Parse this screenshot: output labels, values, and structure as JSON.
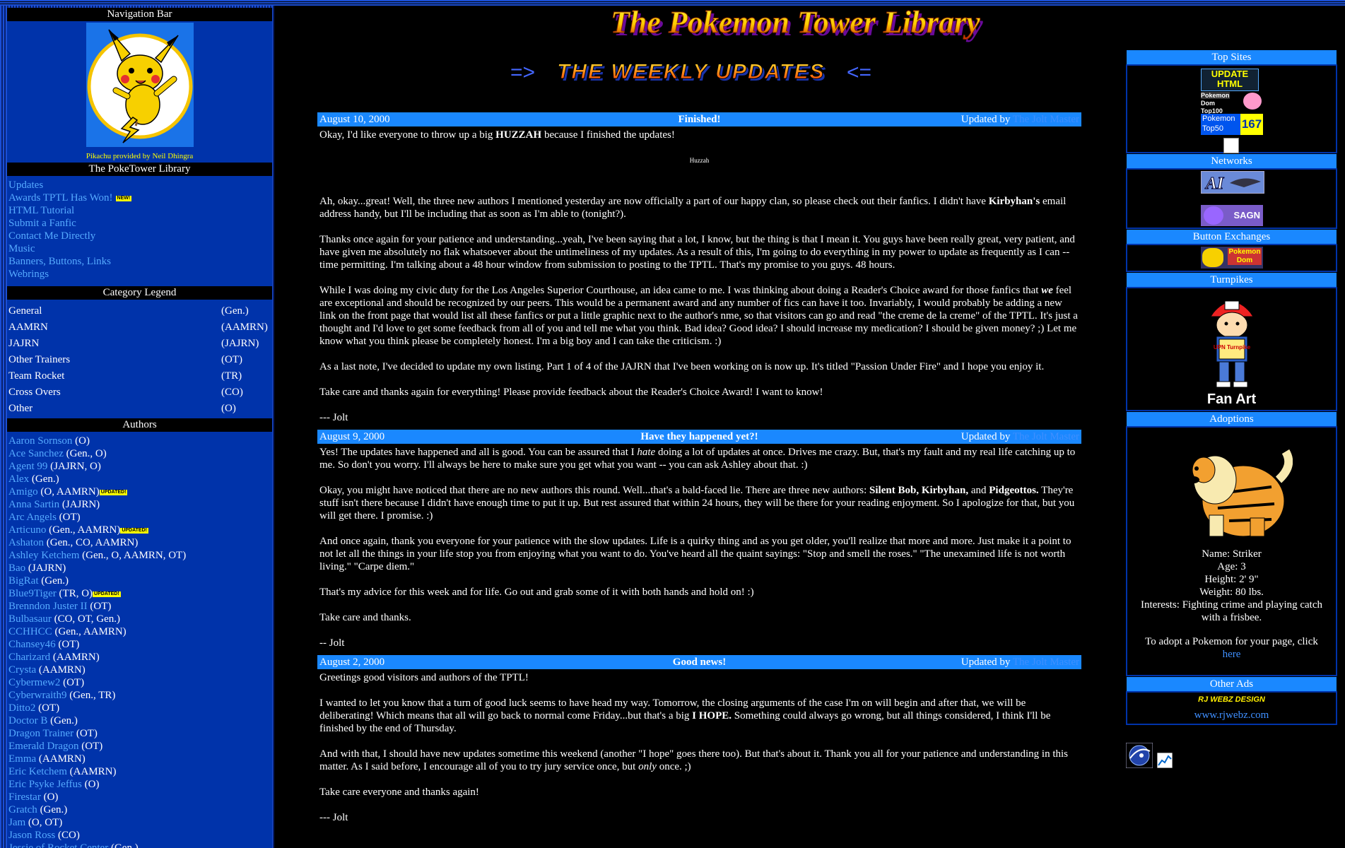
{
  "site_title": "The Pokemon Tower Library",
  "weekly_header": {
    "left_arrow": "=>",
    "text": "THE WEEKLY UPDATES",
    "right_arrow": "<="
  },
  "sidebar": {
    "nav_header": "Navigation Bar",
    "pika_credit": "Pikachu provided by Neil Dhingra",
    "library_header": "The PokeTower Library",
    "links": [
      {
        "label": "Updates"
      },
      {
        "label": "Awards TPTL Has Won!",
        "badge": "NEW!"
      },
      {
        "label": "HTML Tutorial"
      },
      {
        "label": "Submit a Fanfic"
      },
      {
        "label": "Contact Me Directly"
      },
      {
        "label": "Music"
      },
      {
        "label": "Banners, Buttons, Links"
      },
      {
        "label": "Webrings"
      }
    ],
    "legend_header": "Category Legend",
    "legend": [
      {
        "name": "General",
        "code": "(Gen.)"
      },
      {
        "name": "AAMRN",
        "code": "(AAMRN)"
      },
      {
        "name": "JAJRN",
        "code": "(JAJRN)"
      },
      {
        "name": "Other Trainers",
        "code": "(OT)"
      },
      {
        "name": "Team Rocket",
        "code": "(TR)"
      },
      {
        "name": "Cross Overs",
        "code": "(CO)"
      },
      {
        "name": "Other",
        "code": "(O)"
      }
    ],
    "authors_header": "Authors",
    "updated_badge": "UPDATED!",
    "authors": [
      {
        "name": "Aaron Sornson",
        "cats": "(O)"
      },
      {
        "name": "Ace Sanchez",
        "cats": "(Gen., O)"
      },
      {
        "name": "Agent 99",
        "cats": "(JAJRN, O)"
      },
      {
        "name": "Alex",
        "cats": "(Gen.)"
      },
      {
        "name": "Amigo",
        "cats": "(O, AAMRN)",
        "updated": true
      },
      {
        "name": "Anna Sartin",
        "cats": "(JAJRN)"
      },
      {
        "name": "Arc Angels",
        "cats": "(OT)"
      },
      {
        "name": "Articuno",
        "cats": "(Gen., AAMRN)",
        "updated": true
      },
      {
        "name": "Ashaton",
        "cats": "(Gen., CO, AAMRN)"
      },
      {
        "name": "Ashley Ketchem",
        "cats": "(Gen., O, AAMRN, OT)"
      },
      {
        "name": "Bao",
        "cats": "(JAJRN)"
      },
      {
        "name": "BigRat",
        "cats": "(Gen.)"
      },
      {
        "name": "Blue9Tiger",
        "cats": "(TR, O)",
        "updated": true
      },
      {
        "name": "Brenndon Juster II",
        "cats": "(OT)"
      },
      {
        "name": "Bulbasaur",
        "cats": "(CO, OT, Gen.)"
      },
      {
        "name": "CCHHCC",
        "cats": "(Gen., AAMRN)"
      },
      {
        "name": "Chansey46",
        "cats": "(OT)"
      },
      {
        "name": "Charizard",
        "cats": "(AAMRN)"
      },
      {
        "name": "Crysta",
        "cats": "(AAMRN)"
      },
      {
        "name": "Cybermew2",
        "cats": "(OT)"
      },
      {
        "name": "Cyberwraith9",
        "cats": "(Gen., TR)"
      },
      {
        "name": "Ditto2",
        "cats": "(OT)"
      },
      {
        "name": "Doctor B",
        "cats": "(Gen.)"
      },
      {
        "name": "Dragon Trainer",
        "cats": "(OT)"
      },
      {
        "name": "Emerald Dragon",
        "cats": "(OT)"
      },
      {
        "name": "Emma",
        "cats": "(AAMRN)"
      },
      {
        "name": "Eric Ketchem",
        "cats": "(AAMRN)"
      },
      {
        "name": "Eric Psyke Jeffus",
        "cats": "(O)"
      },
      {
        "name": "Firestar",
        "cats": "(O)"
      },
      {
        "name": "Gratch",
        "cats": "(Gen.)"
      },
      {
        "name": "Jam",
        "cats": "(O, OT)"
      },
      {
        "name": "Jason Ross",
        "cats": "(CO)"
      },
      {
        "name": "Jessie of Rocket Center",
        "cats": "(Gen.)"
      }
    ]
  },
  "posts": [
    {
      "date": "August 10, 2000",
      "title": "Finished!",
      "updated_by_label": "Updated by",
      "author": "The Jolt Master"
    },
    {
      "date": "August 9, 2000",
      "title": "Have they happened yet?!",
      "updated_by_label": "Updated by",
      "author": "The Jolt Master"
    },
    {
      "date": "August 2, 2000",
      "title": "Good news!",
      "updated_by_label": "Updated by",
      "author": "The Jolt Master"
    }
  ],
  "post1": {
    "p1a": "Okay, I'd like everyone to throw up a big ",
    "p1b": "HUZZAH",
    "p1c": " because I finished the updates!",
    "huzzah": "Huzzah",
    "p2a": "Ah, okay...great! Well, the three new authors I mentioned yesterday are now officially a part of our happy clan, so please check out their fanfics. I didn't have ",
    "p2b": "Kirbyhan's",
    "p2c": " email address handy, but I'll be including that as soon as I'm able to (tonight?).",
    "p3": "Thanks once again for your patience and understanding...yeah, I've been saying that a lot, I know, but the thing is that I mean it. You guys have been really great, very patient, and have given me absolutely no flak whatsoever about the untimeliness of my updates. As a result of this, I'm going to do everything in my power to update as frequently as I can -- time permitting. I'm talking about a 48 hour window from submission to posting to the TPTL. That's my promise to you guys. 48 hours.",
    "p4a": "While I was doing my civic duty for the Los Angeles Superior Courthouse, an idea came to me. I was thinking about doing a Reader's Choice award for those fanfics that ",
    "p4b": "we",
    "p4c": " feel are exceptional and should be recognized by our peers. This would be a permanent award and any number of fics can have it too. Invariably, I would probably be adding a new link on the front page that would list all these fanfics or put a little graphic next to the author's nme, so that visitors can go and read \"the creme de la creme\" of the TPTL. It's just a thought and I'd love to get some feedback from all of you and tell me what you think. Bad idea? Good idea? I should increase my medication? I should be given money? ;) Let me know what you think please be completely honest. I'm a big boy and I can take the criticism. :)",
    "p5": "As a last note, I've decided to update my own listing. Part 1 of 4 of the JAJRN that I've been working on is now up. It's titled \"Passion Under Fire\" and I hope you enjoy it.",
    "p6": "Take care and thanks again for everything! Please provide feedback about the Reader's Choice Award! I want to know!",
    "sig": "--- Jolt"
  },
  "post2": {
    "p1a": "Yes! The updates have happened and all is good. You can be assured that you can be assured that I ",
    "p1": "Yes! The updates have happened and all is good. You can be assured that I ",
    "p1b": "hate",
    "p1c": " doing a lot of updates at once. Drives me crazy. But, that's my fault and my real life catching up to me. So don't you worry. I'll always be here to make sure you get what you want -- you can ask Ashley about that. :)",
    "p2a": "Okay, you might have noticed that there are no new authors this round. Well...that's a bald-faced lie. There are three new authors: ",
    "p2b": "Silent Bob, Kirbyhan,",
    "p2c": " and ",
    "p2d": "Pidgeottos.",
    "p2e": " They're stuff isn't there because I didn't have enough time to put it up. But rest assured that within 24 hours, they will be there for your reading enjoyment. So I apologize for that, but you will get there. I promise. :)",
    "p3": "And once again, thank you everyone for your patience with the slow updates. Life is a quirky thing and as you get older, you'll realize that more and more. Just make it a point to not let all the things in your life stop you from enjoying what you want to do. You've heard all the quaint sayings: \"Stop and smell the roses.\" \"The unexamined life is not worth living.\" \"Carpe diem.\"",
    "p4": "That's my advice for this week and for life. Go out and grab some of it with both hands and hold on! :)",
    "p5": "Take care and thanks.",
    "sig": "-- Jolt"
  },
  "post3": {
    "p1": "Greetings good visitors and authors of the TPTL!",
    "p2a": "I wanted to let you know that a turn of good luck seems to have head my way. Tomorrow, the closing arguments of the case I'm on will begin and after that, we will be deliberating! Which means that all will go back to normal come Friday...but that's a big ",
    "p2b": "I HOPE.",
    "p2c": " Something could always go wrong, but all things considered, I think I'll be finished by the end of Thursday.",
    "p3a": "And with that, I should have new updates sometime this weekend (another \"I hope\" goes there too). But that's about it. Thank you all for your patience and understanding in this matter. As I said before, I encourage all of you to try jury service once, but ",
    "p3b": "only",
    "p3c": " once. ;)",
    "p4": "Take care everyone and thanks again!",
    "sig": "--- Jolt"
  },
  "rightbar": {
    "top_sites_header": "Top Sites",
    "top_sites_badge1_a": "UPDATE",
    "top_sites_badge1_b": "HTML",
    "top_sites_badge2_a": "Pokemon",
    "top_sites_badge2_b": "Dom",
    "top_sites_badge2_c": "Top100",
    "top_sites_badge3_a": "Pokemon",
    "top_sites_badge3_b": "Top50",
    "top_sites_badge3_num": "167",
    "networks_header": "Networks",
    "network_badge_text": "SAGN",
    "button_exchanges_header": "Button Exchanges",
    "button_exchange_text_a": "Pokemon",
    "button_exchange_text_b": "Dom",
    "turnpikes_header": "Turnpikes",
    "turnpike_shirt": "UPN Turnpike",
    "turnpike_caption": "Fan Art",
    "adoptions_header": "Adoptions",
    "adopt_name": "Name: Striker",
    "adopt_age": "Age: 3",
    "adopt_height": "Height: 2' 9\"",
    "adopt_weight": "Weight: 80 lbs.",
    "adopt_interests": "Interests: Fighting crime and playing catch with a frisbee.",
    "adopt_cta": "To adopt a Pokemon for your page, click",
    "adopt_link": "here",
    "other_ads_header": "Other Ads",
    "ad_brand": "RJ WEBZ DESIGN",
    "ad_url": "www.rjwebz.com"
  },
  "colors": {
    "sidebar_bg": "#0033aa",
    "post_bar": "#1a88ff",
    "link": "#55aaff",
    "badge_yellow": "#ffff00"
  }
}
